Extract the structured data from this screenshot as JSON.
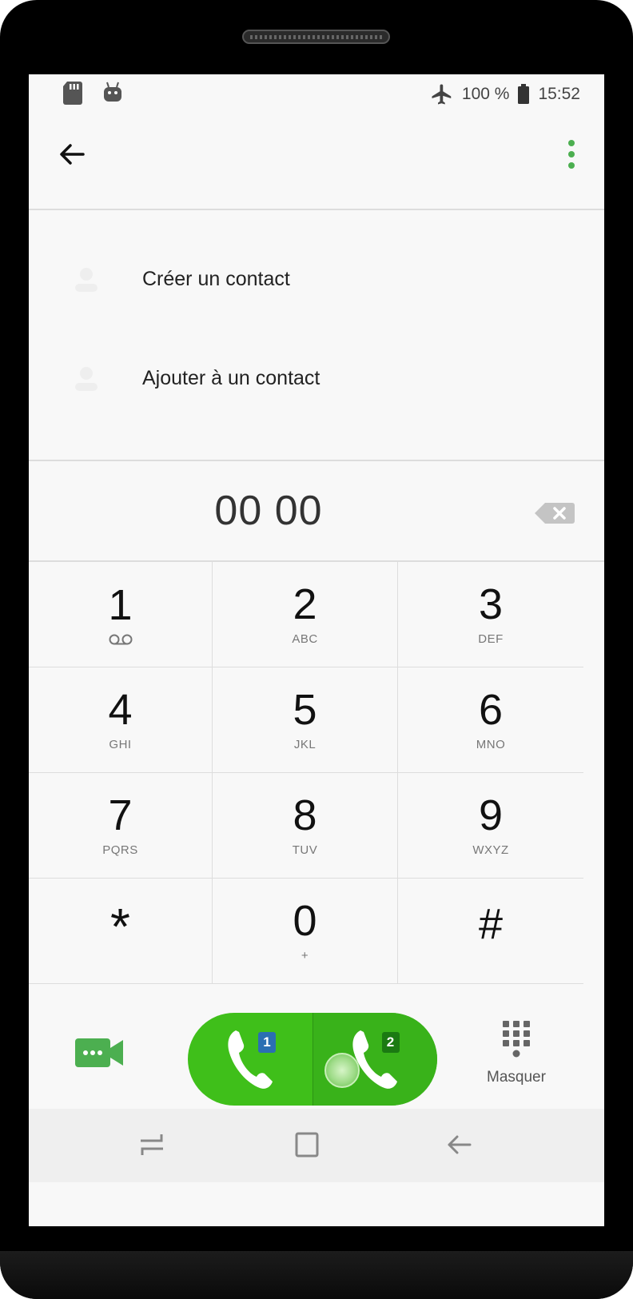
{
  "status_bar": {
    "battery": "100 %",
    "time": "15:52"
  },
  "actions": {
    "create_contact": "Créer un contact",
    "add_to_contact": "Ajouter à un contact"
  },
  "dialer": {
    "number": "00 00"
  },
  "keypad": {
    "keys": [
      {
        "digit": "1",
        "letters": ""
      },
      {
        "digit": "2",
        "letters": "ABC"
      },
      {
        "digit": "3",
        "letters": "DEF"
      },
      {
        "digit": "4",
        "letters": "GHI"
      },
      {
        "digit": "5",
        "letters": "JKL"
      },
      {
        "digit": "6",
        "letters": "MNO"
      },
      {
        "digit": "7",
        "letters": "PQRS"
      },
      {
        "digit": "8",
        "letters": "TUV"
      },
      {
        "digit": "9",
        "letters": "WXYZ"
      },
      {
        "digit": "*",
        "letters": ""
      },
      {
        "digit": "0",
        "letters": "+"
      },
      {
        "digit": "#",
        "letters": ""
      }
    ]
  },
  "bottom": {
    "sim1_label": "1",
    "sim2_label": "2",
    "hide_label": "Masquer"
  },
  "colors": {
    "accent": "#4caf50",
    "call_green": "#3fbf1a",
    "sim1_badge": "#2b6fb3",
    "sim2_badge": "#1b7a12"
  }
}
